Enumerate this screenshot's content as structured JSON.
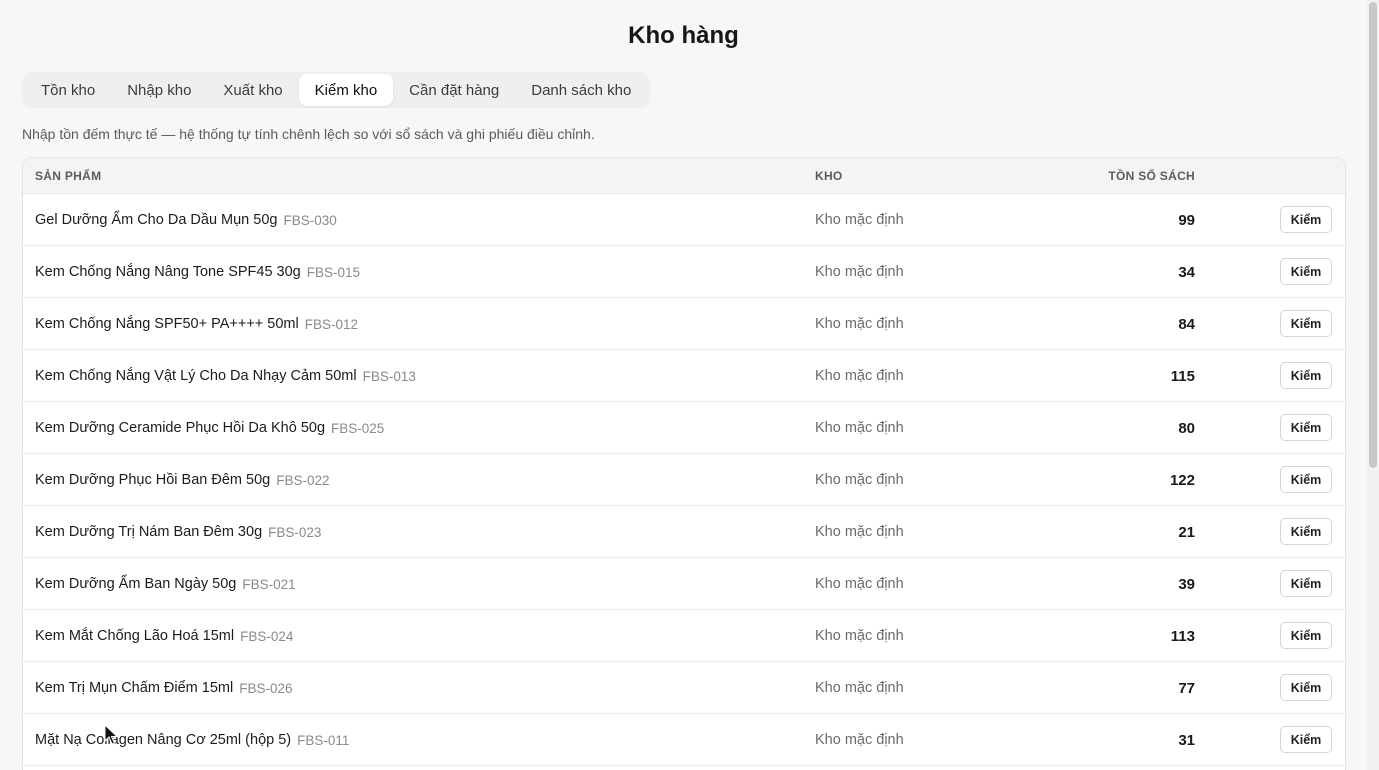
{
  "page": {
    "title": "Kho hàng",
    "hint": "Nhập tồn đếm thực tế — hệ thống tự tính chênh lệch so với sổ sách và ghi phiếu điều chỉnh."
  },
  "tabs": [
    {
      "label": "Tồn kho",
      "active": false
    },
    {
      "label": "Nhập kho",
      "active": false
    },
    {
      "label": "Xuất kho",
      "active": false
    },
    {
      "label": "Kiểm kho",
      "active": true
    },
    {
      "label": "Cần đặt hàng",
      "active": false
    },
    {
      "label": "Danh sách kho",
      "active": false
    }
  ],
  "table": {
    "headers": {
      "product": "SẢN PHẨM",
      "warehouse": "KHO",
      "book_qty": "TỒN SỔ SÁCH"
    },
    "rows": [
      {
        "name": "Gel Dưỡng Ẩm Cho Da Dầu Mụn 50g",
        "sku": "FBS-030",
        "warehouse": "Kho mặc định",
        "qty": "99",
        "action": "Kiểm"
      },
      {
        "name": "Kem Chống Nắng Nâng Tone SPF45 30g",
        "sku": "FBS-015",
        "warehouse": "Kho mặc định",
        "qty": "34",
        "action": "Kiểm"
      },
      {
        "name": "Kem Chống Nắng SPF50+ PA++++ 50ml",
        "sku": "FBS-012",
        "warehouse": "Kho mặc định",
        "qty": "84",
        "action": "Kiểm"
      },
      {
        "name": "Kem Chống Nắng Vật Lý Cho Da Nhạy Cảm 50ml",
        "sku": "FBS-013",
        "warehouse": "Kho mặc định",
        "qty": "115",
        "action": "Kiểm"
      },
      {
        "name": "Kem Dưỡng Ceramide Phục Hồi Da Khô 50g",
        "sku": "FBS-025",
        "warehouse": "Kho mặc định",
        "qty": "80",
        "action": "Kiểm"
      },
      {
        "name": "Kem Dưỡng Phục Hồi Ban Đêm 50g",
        "sku": "FBS-022",
        "warehouse": "Kho mặc định",
        "qty": "122",
        "action": "Kiểm"
      },
      {
        "name": "Kem Dưỡng Trị Nám Ban Đêm 30g",
        "sku": "FBS-023",
        "warehouse": "Kho mặc định",
        "qty": "21",
        "action": "Kiểm"
      },
      {
        "name": "Kem Dưỡng Ẩm Ban Ngày 50g",
        "sku": "FBS-021",
        "warehouse": "Kho mặc định",
        "qty": "39",
        "action": "Kiểm"
      },
      {
        "name": "Kem Mắt Chống Lão Hoá 15ml",
        "sku": "FBS-024",
        "warehouse": "Kho mặc định",
        "qty": "113",
        "action": "Kiểm"
      },
      {
        "name": "Kem Trị Mụn Chấm Điểm 15ml",
        "sku": "FBS-026",
        "warehouse": "Kho mặc định",
        "qty": "77",
        "action": "Kiểm"
      },
      {
        "name": "Mặt Nạ Collagen Nâng Cơ 25ml (hộp 5)",
        "sku": "FBS-011",
        "warehouse": "Kho mặc định",
        "qty": "31",
        "action": "Kiểm"
      }
    ]
  },
  "icons": {
    "cursor": "mouse-pointer-icon"
  }
}
